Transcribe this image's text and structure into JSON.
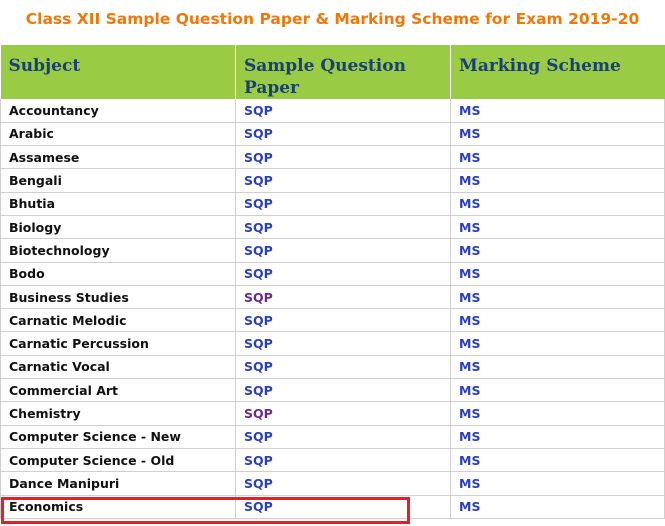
{
  "page": {
    "title": "Class XII Sample Question Paper & Marking Scheme for Exam 2019-20"
  },
  "table": {
    "headers": {
      "subject": "Subject",
      "sqp_line1": "Sample Question",
      "sqp_line2": "Paper",
      "ms": "Marking Scheme"
    },
    "rows": [
      {
        "subject": "Accountancy",
        "sqp": "SQP",
        "ms": "MS",
        "sqp_visited": false
      },
      {
        "subject": "Arabic",
        "sqp": "SQP",
        "ms": "MS",
        "sqp_visited": false
      },
      {
        "subject": "Assamese",
        "sqp": "SQP",
        "ms": "MS",
        "sqp_visited": false
      },
      {
        "subject": "Bengali",
        "sqp": "SQP",
        "ms": "MS",
        "sqp_visited": false
      },
      {
        "subject": "Bhutia",
        "sqp": "SQP",
        "ms": "MS",
        "sqp_visited": false
      },
      {
        "subject": "Biology",
        "sqp": "SQP",
        "ms": "MS",
        "sqp_visited": false
      },
      {
        "subject": "Biotechnology",
        "sqp": "SQP",
        "ms": "MS",
        "sqp_visited": false
      },
      {
        "subject": "Bodo",
        "sqp": "SQP",
        "ms": "MS",
        "sqp_visited": false
      },
      {
        "subject": "Business Studies",
        "sqp": "SQP",
        "ms": "MS",
        "sqp_visited": true
      },
      {
        "subject": "Carnatic Melodic",
        "sqp": "SQP",
        "ms": "MS",
        "sqp_visited": false
      },
      {
        "subject": "Carnatic Percussion",
        "sqp": "SQP",
        "ms": "MS",
        "sqp_visited": false
      },
      {
        "subject": "Carnatic Vocal",
        "sqp": "SQP",
        "ms": "MS",
        "sqp_visited": false
      },
      {
        "subject": "Commercial Art",
        "sqp": "SQP",
        "ms": "MS",
        "sqp_visited": false
      },
      {
        "subject": "Chemistry",
        "sqp": "SQP",
        "ms": "MS",
        "sqp_visited": true
      },
      {
        "subject": "Computer Science - New",
        "sqp": "SQP",
        "ms": "MS",
        "sqp_visited": false
      },
      {
        "subject": "Computer Science - Old",
        "sqp": "SQP",
        "ms": "MS",
        "sqp_visited": false
      },
      {
        "subject": "Dance Manipuri",
        "sqp": "SQP",
        "ms": "MS",
        "sqp_visited": false
      },
      {
        "subject": "Economics",
        "sqp": "SQP",
        "ms": "MS",
        "sqp_visited": false,
        "highlighted": true
      }
    ]
  },
  "colors": {
    "title": "#f0770a",
    "header_bg": "#99cc44",
    "header_text": "#1a3f7a",
    "link": "#2a3fc0",
    "visited_link": "#6b2a8a",
    "highlight_border": "#e0202a"
  }
}
